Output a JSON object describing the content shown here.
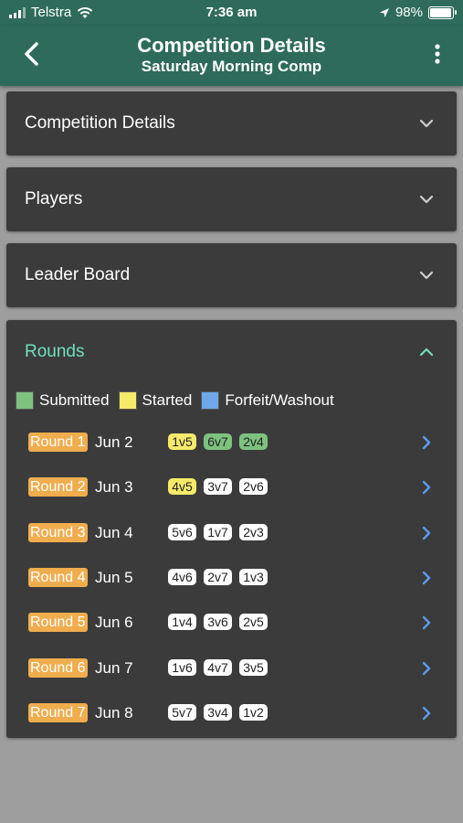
{
  "status": {
    "carrier": "Telstra",
    "time": "7:36 am",
    "battery": "98%"
  },
  "appbar": {
    "title": "Competition Details",
    "subtitle": "Saturday Morning Comp"
  },
  "sections": {
    "details": "Competition Details",
    "players": "Players",
    "leaderboard": "Leader Board",
    "rounds": "Rounds"
  },
  "legend": [
    {
      "label": "Submitted",
      "color": "#7dc27f"
    },
    {
      "label": "Started",
      "color": "#f6ea6a"
    },
    {
      "label": "Forfeit/Washout",
      "color": "#6fa8e8"
    }
  ],
  "rounds": [
    {
      "label": "Round 1",
      "date": "Jun 2",
      "matches": [
        {
          "t": "1v5",
          "s": "started"
        },
        {
          "t": "6v7",
          "s": "submitted"
        },
        {
          "t": "2v4",
          "s": "submitted"
        }
      ]
    },
    {
      "label": "Round 2",
      "date": "Jun 3",
      "matches": [
        {
          "t": "4v5",
          "s": "started"
        },
        {
          "t": "3v7",
          "s": ""
        },
        {
          "t": "2v6",
          "s": ""
        }
      ]
    },
    {
      "label": "Round 3",
      "date": "Jun 4",
      "matches": [
        {
          "t": "5v6",
          "s": ""
        },
        {
          "t": "1v7",
          "s": ""
        },
        {
          "t": "2v3",
          "s": ""
        }
      ]
    },
    {
      "label": "Round 4",
      "date": "Jun 5",
      "matches": [
        {
          "t": "4v6",
          "s": ""
        },
        {
          "t": "2v7",
          "s": ""
        },
        {
          "t": "1v3",
          "s": ""
        }
      ]
    },
    {
      "label": "Round 5",
      "date": "Jun 6",
      "matches": [
        {
          "t": "1v4",
          "s": ""
        },
        {
          "t": "3v6",
          "s": ""
        },
        {
          "t": "2v5",
          "s": ""
        }
      ]
    },
    {
      "label": "Round 6",
      "date": "Jun 7",
      "matches": [
        {
          "t": "1v6",
          "s": ""
        },
        {
          "t": "4v7",
          "s": ""
        },
        {
          "t": "3v5",
          "s": ""
        }
      ]
    },
    {
      "label": "Round 7",
      "date": "Jun 8",
      "matches": [
        {
          "t": "5v7",
          "s": ""
        },
        {
          "t": "3v4",
          "s": ""
        },
        {
          "t": "1v2",
          "s": ""
        }
      ]
    }
  ],
  "colors": {
    "accent": "#6fe0c0",
    "header": "#2e6b5a",
    "card": "#3b3b3b",
    "round_tag": "#f0ad4e",
    "arrow": "#5b9bf0"
  }
}
